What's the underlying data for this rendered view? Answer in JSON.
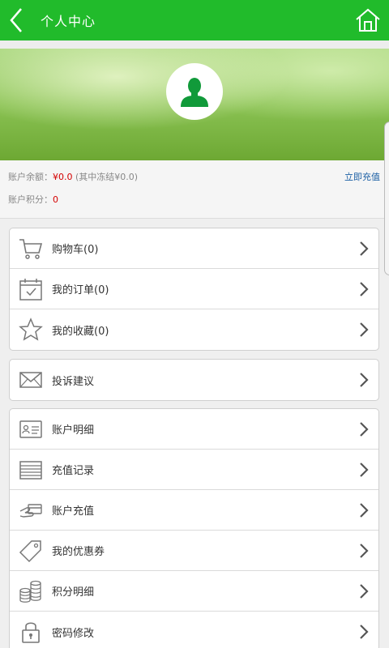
{
  "header": {
    "title": "个人中心",
    "back_icon": "back-chevron-icon",
    "home_icon": "home-icon",
    "bg_color": "#21bb2b"
  },
  "account": {
    "balance_label": "账户余额：",
    "balance_value": "¥0.0",
    "frozen_text": "(其中冻结¥0.0)",
    "points_label": "账户积分：",
    "points_value": "0",
    "recharge_link": "立即充值"
  },
  "group1": [
    {
      "label": "购物车(0)",
      "icon": "cart-icon"
    },
    {
      "label": "我的订单(0)",
      "icon": "calendar-check-icon"
    },
    {
      "label": "我的收藏(0)",
      "icon": "star-icon"
    }
  ],
  "group2": [
    {
      "label": "投诉建议",
      "icon": "envelope-icon"
    }
  ],
  "group3": [
    {
      "label": "账户明细",
      "icon": "id-card-icon"
    },
    {
      "label": "充值记录",
      "icon": "list-icon"
    },
    {
      "label": "账户充值",
      "icon": "card-hand-icon"
    },
    {
      "label": "我的优惠券",
      "icon": "tag-icon"
    },
    {
      "label": "积分明细",
      "icon": "coins-icon"
    },
    {
      "label": "密码修改",
      "icon": "lock-icon"
    }
  ]
}
